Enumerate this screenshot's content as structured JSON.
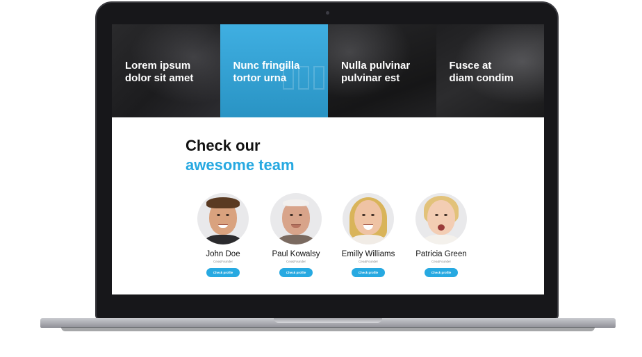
{
  "hero": {
    "tiles": [
      {
        "line1": "Lorem ipsum",
        "line2": "dolor sit amet"
      },
      {
        "line1": "Nunc fringilla",
        "line2": "tortor urna"
      },
      {
        "line1": "Nulla pulvinar",
        "line2": "pulvinar est"
      },
      {
        "line1": "Fusce at",
        "line2": "diam condim"
      }
    ]
  },
  "section": {
    "heading_line1": "Check our",
    "heading_line2": "awesome team"
  },
  "team": [
    {
      "name": "John Doe",
      "role": "Ceo&Founder",
      "button": "Check profile"
    },
    {
      "name": "Paul Kowalsy",
      "role": "Ceo&Founder",
      "button": "Check profile"
    },
    {
      "name": "Emilly Williams",
      "role": "Ceo&Founder",
      "button": "Check profile"
    },
    {
      "name": "Patricia Green",
      "role": "Ceo&Founder",
      "button": "Check profile"
    }
  ],
  "colors": {
    "accent": "#27a9e1",
    "hero_dark": "#1c1c1e",
    "text": "#111111"
  }
}
